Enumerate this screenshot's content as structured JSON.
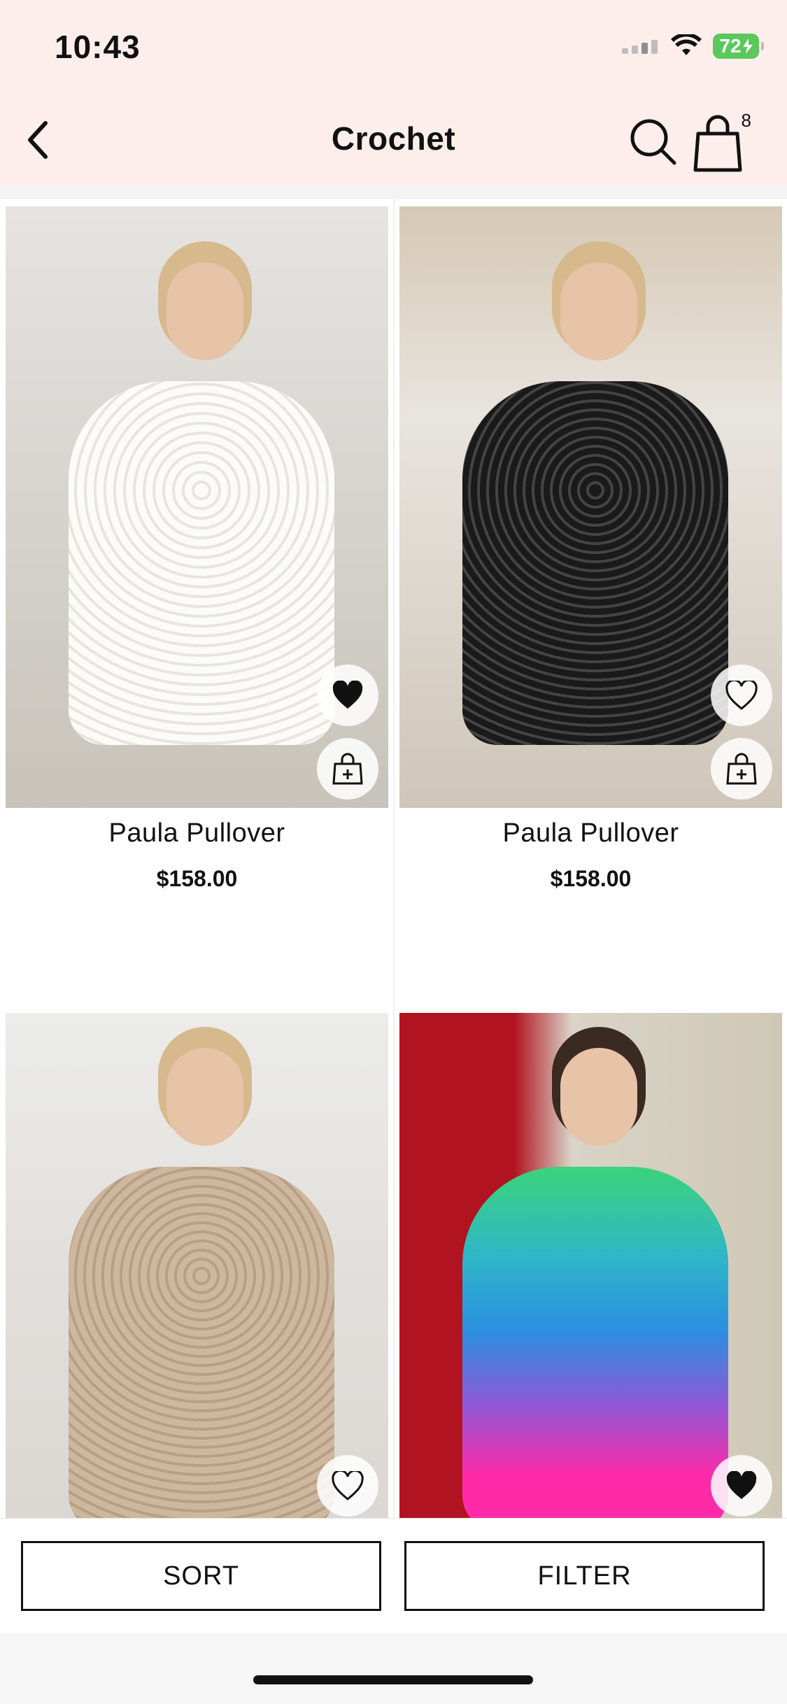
{
  "status_bar": {
    "time": "10:43",
    "battery": "72",
    "battery_color": "#5ac85a"
  },
  "header": {
    "title": "Crochet",
    "back_icon": "chevron-left-icon",
    "search_icon": "search-icon",
    "bag_icon": "shopping-bag-icon",
    "bag_count": "8",
    "background": "#fdeeeb"
  },
  "products": [
    {
      "name": "Paula Pullover",
      "price": "$158.00",
      "wishlisted": true,
      "color_variant": "white"
    },
    {
      "name": "Paula Pullover",
      "price": "$158.00",
      "wishlisted": false,
      "color_variant": "black"
    },
    {
      "name": "",
      "price": "",
      "wishlisted": false,
      "color_variant": "beige"
    },
    {
      "name": "",
      "price": "",
      "wishlisted": true,
      "color_variant": "rainbow"
    }
  ],
  "bottom_bar": {
    "sort_label": "SORT",
    "filter_label": "FILTER"
  }
}
